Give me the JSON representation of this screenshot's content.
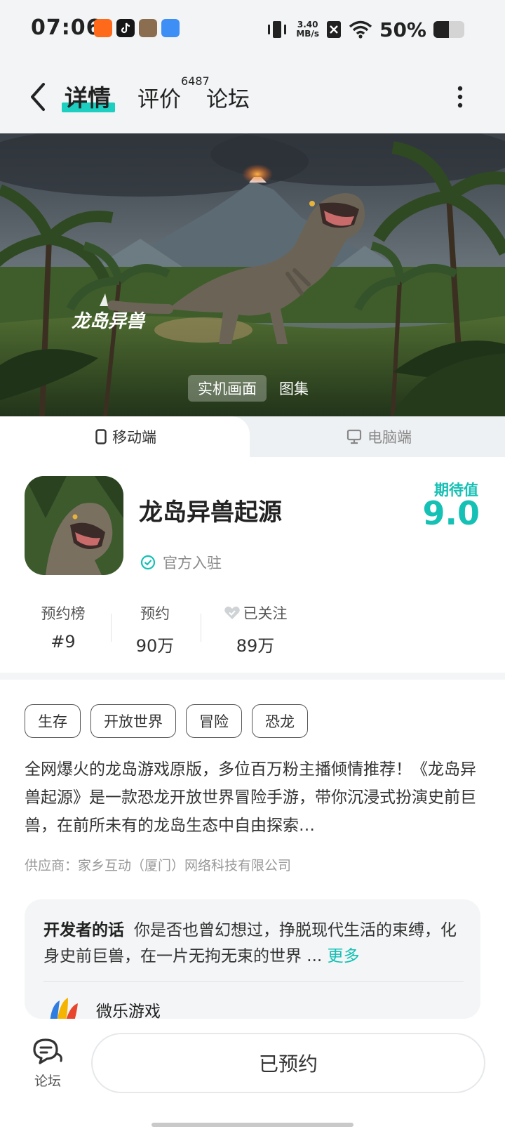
{
  "status_bar": {
    "time": "07:06",
    "speed_value": "3.40",
    "speed_unit": "MB/s",
    "battery_percent": "50%",
    "battery_level": 0.5,
    "app_icons": [
      "kuaishou-icon",
      "douyin-icon",
      "game-icon",
      "files-icon"
    ]
  },
  "nav": {
    "tabs": [
      {
        "label": "详情",
        "active": true
      },
      {
        "label": "评价",
        "badge": "6487"
      },
      {
        "label": "论坛"
      }
    ]
  },
  "hero": {
    "logo_text": "龙岛异兽",
    "tabs": [
      "实机画面",
      "图集"
    ]
  },
  "platform": {
    "mobile": "移动端",
    "pc": "电脑端"
  },
  "game": {
    "title": "龙岛异兽起源",
    "official": "官方入驻",
    "expect_label": "期待值",
    "expect_value": "9.0",
    "stats": [
      {
        "label": "预约榜",
        "value": "#9"
      },
      {
        "label": "预约",
        "value": "90万"
      },
      {
        "label": "已关注",
        "value": "89万"
      }
    ],
    "tags": [
      "生存",
      "开放世界",
      "冒险",
      "恐龙"
    ],
    "description": "全网爆火的龙岛游戏原版，多位百万粉主播倾情推荐！《龙岛异兽起源》是一款恐龙开放世界冒险手游，带你沉浸式扮演史前巨兽，在前所未有的龙岛生态中自由探索…",
    "supplier": "供应商：家乡互动（厦门）网络科技有限公司"
  },
  "developer": {
    "title": "开发者的话",
    "text": "你是否也曾幻想过，挣脱现代生活的束缚，化身史前巨兽，在一片无拘无束的世界 ...",
    "more": "更多",
    "name": "微乐游戏"
  },
  "bottom": {
    "forum_label": "论坛",
    "reserve_label": "已预约"
  },
  "colors": {
    "accent": "#15c0b4",
    "underline": "#1ccfc0"
  }
}
